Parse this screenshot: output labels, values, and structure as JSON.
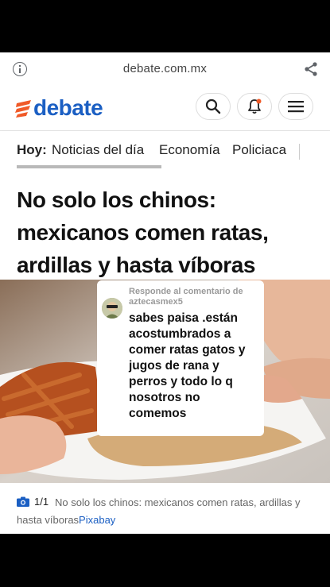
{
  "browser": {
    "url": "debate.com.mx"
  },
  "header": {
    "logo_text": "debate",
    "brand_color": "#1b5fc3",
    "icons": [
      "search-icon",
      "bell-icon",
      "menu-icon"
    ]
  },
  "nav": {
    "label": "Hoy:",
    "items": [
      "Noticias del día",
      "Economía",
      "Policiaca"
    ]
  },
  "article": {
    "headline": "No solo los chinos: mexicanos comen ratas, ardillas y hasta víboras"
  },
  "overlay": {
    "reply_label": "Responde al comentario de",
    "username": "aztecasmex5",
    "comment": "sabes paisa .están acostumbrados a comer ratas gatos y jugos de rana y perros y todo lo q nosotros no comemos"
  },
  "caption": {
    "count": "1/1",
    "text": "No solo los chinos: mexicanos comen ratas, ardillas y hasta víboras",
    "credit": "Pixabay"
  }
}
